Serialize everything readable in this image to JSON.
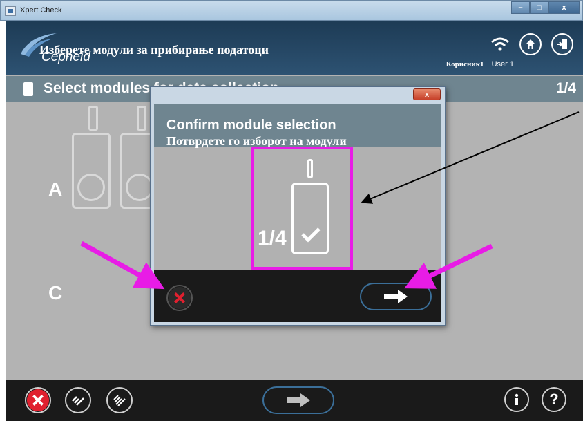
{
  "window": {
    "title": "Xpert Check",
    "minimize": "–",
    "maximize": "□",
    "close": "x"
  },
  "header": {
    "logo": "Cepheid",
    "user_label_mk": "Корисник1",
    "user_label_en": "User 1"
  },
  "annotation": {
    "page_caption_mk": "Изберете модули за прибирање податоци",
    "modal_caption_mk": "Потврдете го изборот на модули",
    "accent_color": "#e81ce6"
  },
  "section": {
    "title": "Select modules for data collection",
    "page_indicator": "1/4"
  },
  "rows": {
    "a": "A",
    "c": "C"
  },
  "modal": {
    "close_glyph": "x",
    "title": "Confirm module selection",
    "module_count": "1/4"
  },
  "colors": {
    "header": "#1d3b55",
    "section_bar": "#6f8590",
    "content": "#b3b3b3",
    "footer": "#1a1a1a",
    "cancel_red": "#e0202f",
    "arrow_blue": "#3b6f99"
  },
  "icons": [
    "wifi-icon",
    "home-icon",
    "exit-icon",
    "cancel-icon",
    "checklist-icon",
    "checklist-all-icon",
    "arrow-right-icon",
    "info-icon",
    "help-icon"
  ]
}
